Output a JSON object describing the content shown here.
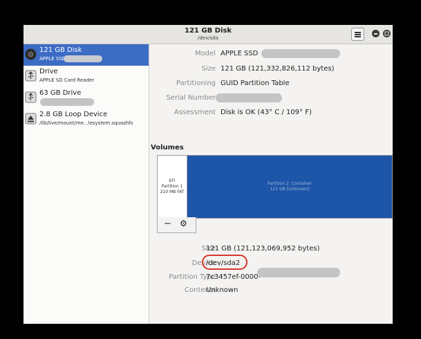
{
  "window": {
    "title": "121 GB Disk",
    "subtitle": "/dev/sda",
    "menu_icon": "hamburger-menu-icon",
    "controls": [
      "minimize-icon",
      "maximize-icon",
      "close-icon"
    ]
  },
  "sidebar": {
    "items": [
      {
        "title": "121 GB Disk",
        "subtitle": "APPLE SSD",
        "icon": "disk-icon",
        "selected": true
      },
      {
        "title": "Drive",
        "subtitle": "APPLE SD Card Reader",
        "icon": "usb-drive-icon",
        "selected": false
      },
      {
        "title": "63 GB Drive",
        "subtitle": "",
        "icon": "usb-drive-icon",
        "selected": false
      },
      {
        "title": "2.8 GB Loop Device",
        "subtitle": "/lib/live/mount/me...lesystem.squashfs",
        "icon": "eject-icon",
        "selected": false
      }
    ]
  },
  "disk_info": {
    "model_label": "Model",
    "model_value": "APPLE SSD",
    "size_label": "Size",
    "size_value": "121 GB (121,332,826,112 bytes)",
    "partitioning_label": "Partitioning",
    "partitioning_value": "GUID Partition Table",
    "serial_label": "Serial Number",
    "serial_value": "",
    "assessment_label": "Assessment",
    "assessment_value": "Disk is OK (43° C / 109° F)"
  },
  "volumes": {
    "heading": "Volumes",
    "partitions": [
      {
        "line1": "EFI",
        "line2": "Partition 1",
        "line3": "210 MB FAT"
      },
      {
        "line1": "Partition 2: Container",
        "line2": "121 GB [Unknown]"
      }
    ],
    "toolbar": {
      "remove_label": "−",
      "settings_icon": "gears-icon"
    }
  },
  "partition_info": {
    "size_label": "Size",
    "size_value": "121 GB (121,123,069,952 bytes)",
    "device_label": "Device",
    "device_value": "/dev/sda2",
    "type_label": "Partition Type",
    "type_value": "7c3457ef-0000-",
    "contents_label": "Contents",
    "contents_value": "Unknown"
  },
  "colors": {
    "selection": "#3d6cc5",
    "partition_blue": "#1d55a8",
    "highlight_ring": "#d8382c"
  }
}
